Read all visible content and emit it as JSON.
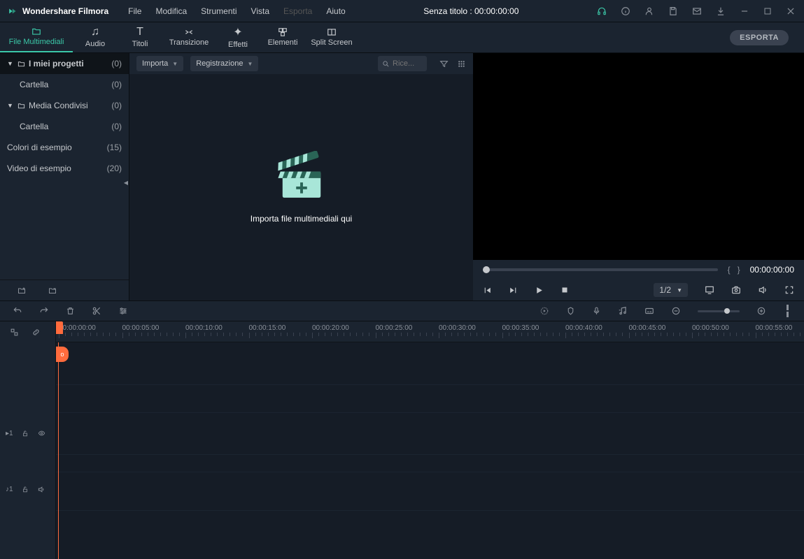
{
  "app": {
    "name": "Wondershare Filmora"
  },
  "menu": {
    "file": "File",
    "edit": "Modifica",
    "tools": "Strumenti",
    "view": "Vista",
    "export": "Esporta",
    "help": "Aiuto"
  },
  "title": "Senza titolo : 00:00:00:00",
  "tabs": {
    "media": "File Multimediali",
    "audio": "Audio",
    "titles": "Titoli",
    "transition": "Transizione",
    "effects": "Effetti",
    "elements": "Elementi",
    "split": "Split Screen"
  },
  "exportBtn": "ESPORTA",
  "sidebar": {
    "items": [
      {
        "label": "I miei progetti",
        "count": "(0)",
        "sel": true,
        "arrow": true,
        "folder": true,
        "bold": true
      },
      {
        "label": "Cartella",
        "count": "(0)",
        "child": true
      },
      {
        "label": "Media Condivisi",
        "count": "(0)",
        "arrow": true,
        "folder": true
      },
      {
        "label": "Cartella",
        "count": "(0)",
        "child": true
      },
      {
        "label": "Colori di esempio",
        "count": "(15)"
      },
      {
        "label": "Video di esempio",
        "count": "(20)"
      }
    ]
  },
  "mediaTop": {
    "import": "Importa",
    "record": "Registrazione",
    "searchPlaceholder": "Rice..."
  },
  "mediaBody": {
    "prompt": "Importa file multimediali qui"
  },
  "preview": {
    "time": "00:00:00:00",
    "quality": "1/2",
    "braces": {
      "l": "{",
      "r": "}"
    }
  },
  "ruler": [
    "00:00:00:00",
    "00:00:05:00",
    "00:00:10:00",
    "00:00:15:00",
    "00:00:20:00",
    "00:00:25:00",
    "00:00:30:00",
    "00:00:35:00",
    "00:00:40:00",
    "00:00:45:00",
    "00:00:50:00",
    "00:00:55:00"
  ],
  "tracks": {
    "video": "1",
    "audio": "1",
    "marker": "o"
  }
}
